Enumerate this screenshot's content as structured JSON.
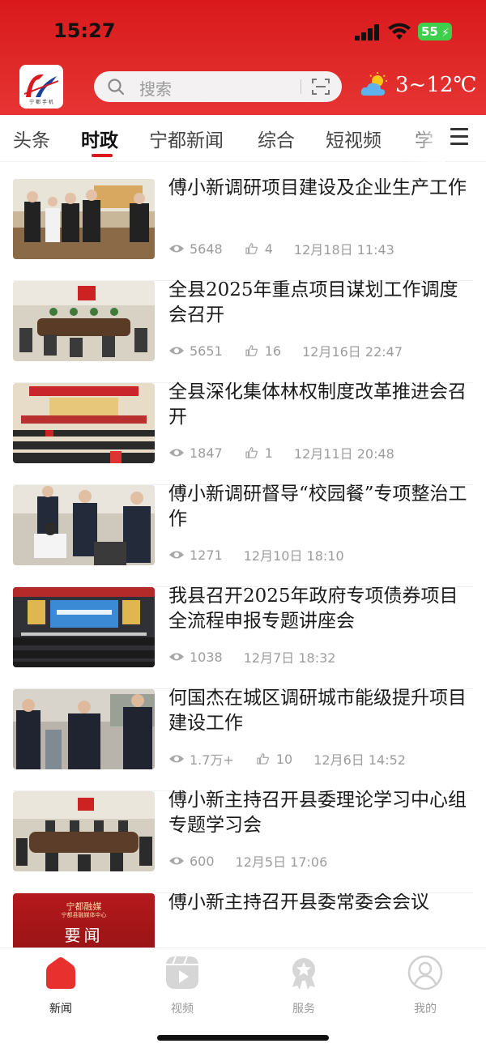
{
  "status_bar": {
    "time": "15:27",
    "battery": "55"
  },
  "header": {
    "logo_text": "宁 都 手 机",
    "search_placeholder": "搜索",
    "weather": "3~12℃",
    "brand_color": "#d9191c"
  },
  "tabs": [
    {
      "label": "头条",
      "active": false
    },
    {
      "label": "时政",
      "active": true
    },
    {
      "label": "宁都新闻",
      "active": false
    },
    {
      "label": "综合",
      "active": false
    },
    {
      "label": "短视频",
      "active": false
    },
    {
      "label": "学",
      "active": false
    }
  ],
  "news": [
    {
      "title": "傅小新调研项目建设及企业生产工作",
      "views": "5648",
      "likes": "4",
      "date": "12月18日  11:43"
    },
    {
      "title": "全县2025年重点项目谋划工作调度会召开",
      "views": "5651",
      "likes": "16",
      "date": "12月16日  22:47"
    },
    {
      "title": "全县深化集体林权制度改革推进会召开",
      "views": "1847",
      "likes": "1",
      "date": "12月11日  20:48"
    },
    {
      "title": "傅小新调研督导“校园餐”专项整治工作",
      "views": "1271",
      "likes": null,
      "date": "12月10日  18:10"
    },
    {
      "title": "我县召开2025年政府专项债券项目全流程申报专题讲座会",
      "views": "1038",
      "likes": null,
      "date": "12月7日  18:32"
    },
    {
      "title": "何国杰在城区调研城市能级提升项目建设工作",
      "views": "1.7万+",
      "likes": "10",
      "date": "12月6日  14:52"
    },
    {
      "title": "傅小新主持召开县委理论学习中心组专题学习会",
      "views": "600",
      "likes": null,
      "date": "12月5日  17:06"
    },
    {
      "title": "傅小新主持召开县委常委会会议",
      "views": null,
      "likes": null,
      "date": null
    }
  ],
  "last_thumb": {
    "top_text": "宁都融媒",
    "sub_text": "宁都县融媒体中心",
    "main_text": "要闻"
  },
  "bottom_nav": [
    {
      "label": "新闻",
      "icon": "home-icon",
      "active": true
    },
    {
      "label": "视频",
      "icon": "video-icon",
      "active": false
    },
    {
      "label": "服务",
      "icon": "service-icon",
      "active": false
    },
    {
      "label": "我的",
      "icon": "profile-icon",
      "active": false
    }
  ]
}
